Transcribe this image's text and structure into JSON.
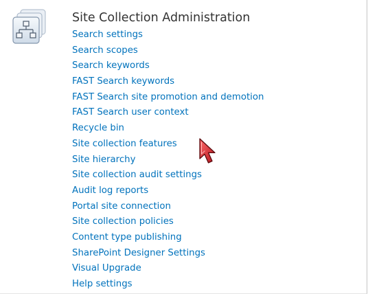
{
  "section": {
    "title": "Site Collection Administration",
    "icon": "site-hierarchy-icon",
    "links": [
      {
        "label": "Search settings"
      },
      {
        "label": "Search scopes"
      },
      {
        "label": "Search keywords"
      },
      {
        "label": "FAST Search keywords"
      },
      {
        "label": "FAST Search site promotion and demotion"
      },
      {
        "label": "FAST Search user context"
      },
      {
        "label": "Recycle bin"
      },
      {
        "label": "Site collection features"
      },
      {
        "label": "Site hierarchy"
      },
      {
        "label": "Site collection audit settings"
      },
      {
        "label": "Audit log reports"
      },
      {
        "label": "Portal site connection"
      },
      {
        "label": "Site collection policies"
      },
      {
        "label": "Content type publishing"
      },
      {
        "label": "SharePoint Designer Settings"
      },
      {
        "label": "Visual Upgrade"
      },
      {
        "label": "Help settings"
      }
    ]
  },
  "colors": {
    "link": "#0072bc",
    "title": "#333333",
    "cursor": "#d0202a"
  },
  "cursor": {
    "icon": "mouse-pointer-icon"
  }
}
